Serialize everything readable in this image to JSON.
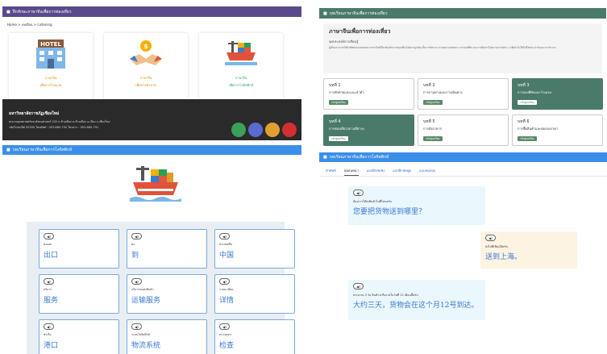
{
  "panel_a": {
    "header_title": "ฝึกทักษะภาษาจีนเพื่อการท่องเที่ยว",
    "breadcrumb": "Home > บทเรียน > Listening",
    "cards": [
      {
        "t1": "ภาษาจีน",
        "t2": "เพื่อการโรงแรม",
        "icon": "hotel-icon"
      },
      {
        "t1": "ภาษาจีน",
        "t2": "เพื่อการค้าขาย",
        "icon": "handshake-icon"
      },
      {
        "t1": "ภาษาจีน",
        "t2": "เพื่อการโลจิสติกส์",
        "icon": "cargo-ship-icon"
      }
    ],
    "footer": {
      "org": "มหาวิทยาลัยราชภัฏเชียงใหม่",
      "address": "คณะมนุษยศาสตร์และสังคมศาสตร์ 202 ถ.ช้างเผือก ต.ช้างเผือก อ.เมือง จ.เชียงใหม่",
      "contact": "รหัสไปรษณีย์ 50300 โทรศัพท์ : 053-885-750 โทรสาร : 053-885-751"
    }
  },
  "panel_b": {
    "header_title": "บทเรียนภาษาจีนเพื่อการท่องเที่ยว",
    "hero_title": "ภาษาจีนเพื่อการท่องเที่ยว",
    "hero_subtitle": "จุดประสงค์การเรียนรู้",
    "hero_desc": "ผู้เรียนสามารถใช้คำศัพท์และบทสนทนาภาษาจีนที่เกี่ยวข้องกับการท่องเที่ยวได้อย่างถูกต้อง ทั้งการทักทาย การสอบถามเส้นทาง การจองที่พัก และการสื่อสารในสถานการณ์ต่าง ๆ เพื่อนำไปใช้ในชีวิตประจำวันและการทำงาน",
    "units": [
      {
        "n": "บทที่ 1",
        "title": "การทักทายและแนะนำตัว",
        "btn": "เข้าสู่บทเรียน",
        "dark": false
      },
      {
        "n": "บทที่ 2",
        "title": "การถามทางและการเดินทาง",
        "btn": "เข้าสู่บทเรียน",
        "dark": false
      },
      {
        "n": "บทที่ 3",
        "title": "การจองที่พักและโรงแรม",
        "btn": "เข้าสู่บทเรียน",
        "dark": true
      },
      {
        "n": "บทที่ 4",
        "title": "การท่องเที่ยวสถานที่ต่างๆ",
        "btn": "เข้าสู่บทเรียน",
        "dark": true
      },
      {
        "n": "บทที่ 5",
        "title": "การสั่งอาหาร",
        "btn": "เข้าสู่บทเรียน",
        "dark": false
      },
      {
        "n": "บทที่ 6",
        "title": "การซื้อสินค้าและต่อรองราคา",
        "btn": "เข้าสู่บทเรียน",
        "dark": false
      }
    ]
  },
  "panel_c": {
    "header_title": "บทเรียนภาษาจีนเพื่อการโลจิสติกส์",
    "vocab": [
      {
        "th": "ส่งออก",
        "zh": "出口"
      },
      {
        "th": "ส่ง",
        "zh": "到"
      },
      {
        "th": "ประเทศจีน",
        "zh": "中国"
      },
      {
        "th": "บริการ",
        "zh": "服务"
      },
      {
        "th": "บริการขนส่งสินค้า",
        "zh": "运输服务"
      },
      {
        "th": "รายละเอียด",
        "zh": "详情"
      },
      {
        "th": "ท่าเรือ",
        "zh": "港口"
      },
      {
        "th": "ระบบโลจิสติกส์",
        "zh": "物流系统"
      },
      {
        "th": "ตรวจสอบ",
        "zh": "检查"
      }
    ]
  },
  "panel_d": {
    "header_title": "บทเรียนภาษาจีนเพื่อการโลจิสติกส์",
    "tabs": [
      "คำศัพท์",
      "บทสนทนา",
      "แบบฝึกหัดฟัง",
      "แบบฝึกหัดพูด",
      "แบบทดสอบ"
    ],
    "dialog": [
      {
        "side": "left",
        "th": "ต้องการให้ส่งสินค้าไปที่ไหนครับ",
        "zh": "您要把货物送到哪里？"
      },
      {
        "side": "right",
        "th": "ส่งไปที่เซี่ยงไฮ้ครับ",
        "zh": "送到上海。"
      },
      {
        "side": "left",
        "th": "ประมาณ 3 วัน สินค้าจะถึงภายในวันที่ 12 เดือนนี้ครับ",
        "zh": "大约三天，货物会在这个月12号到达。"
      }
    ]
  }
}
